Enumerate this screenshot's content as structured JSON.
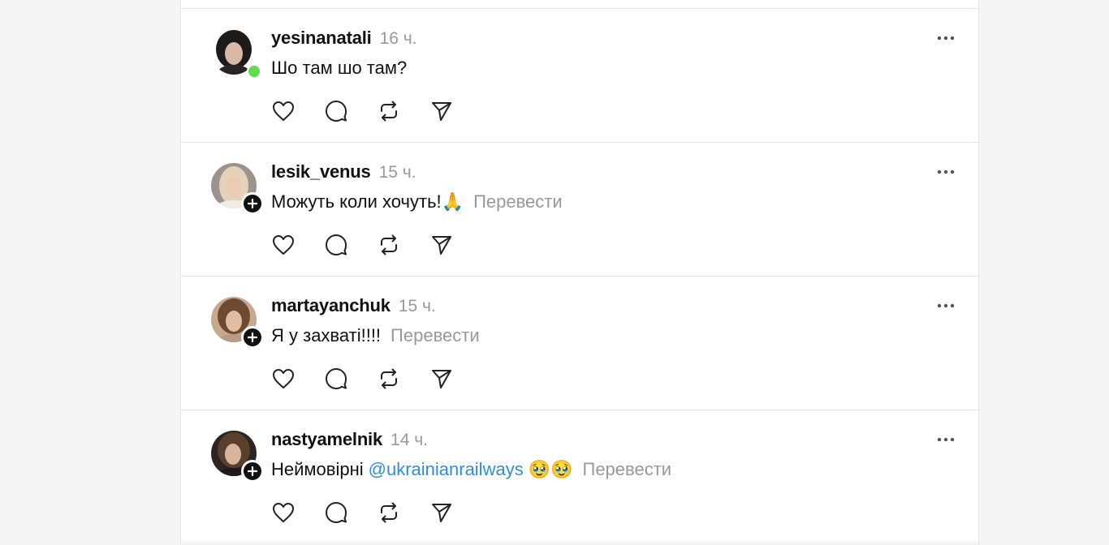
{
  "posts": [
    {
      "username": "yesinanatali",
      "time": "16 ч.",
      "text": "Шо там шо там?",
      "mention": "",
      "emoji": "",
      "translate": "",
      "avatar_badge": "online-dot"
    },
    {
      "username": "lesik_venus",
      "time": "15 ч.",
      "text": "Можуть коли хочуть!🙏",
      "mention": "",
      "emoji": "",
      "translate": "Перевести",
      "avatar_badge": "follow-plus-icon"
    },
    {
      "username": "martayanchuk",
      "time": "15 ч.",
      "text": "Я у захваті!!!!",
      "mention": "",
      "emoji": "",
      "translate": "Перевести",
      "avatar_badge": "follow-plus-icon"
    },
    {
      "username": "nastyamelnik",
      "time": "14 ч.",
      "text": "Неймовірні",
      "mention": "@ukrainianrailways",
      "emoji": "🥹🥹",
      "translate": "Перевести",
      "avatar_badge": "follow-plus-icon"
    }
  ],
  "icons": {
    "like": "heart-icon",
    "reply": "comment-icon",
    "repost": "repost-icon",
    "share": "send-icon",
    "more": "more-dots-icon"
  },
  "colors": {
    "online": "#5ee04b",
    "mention": "#2f8ed8",
    "muted": "#999999"
  }
}
